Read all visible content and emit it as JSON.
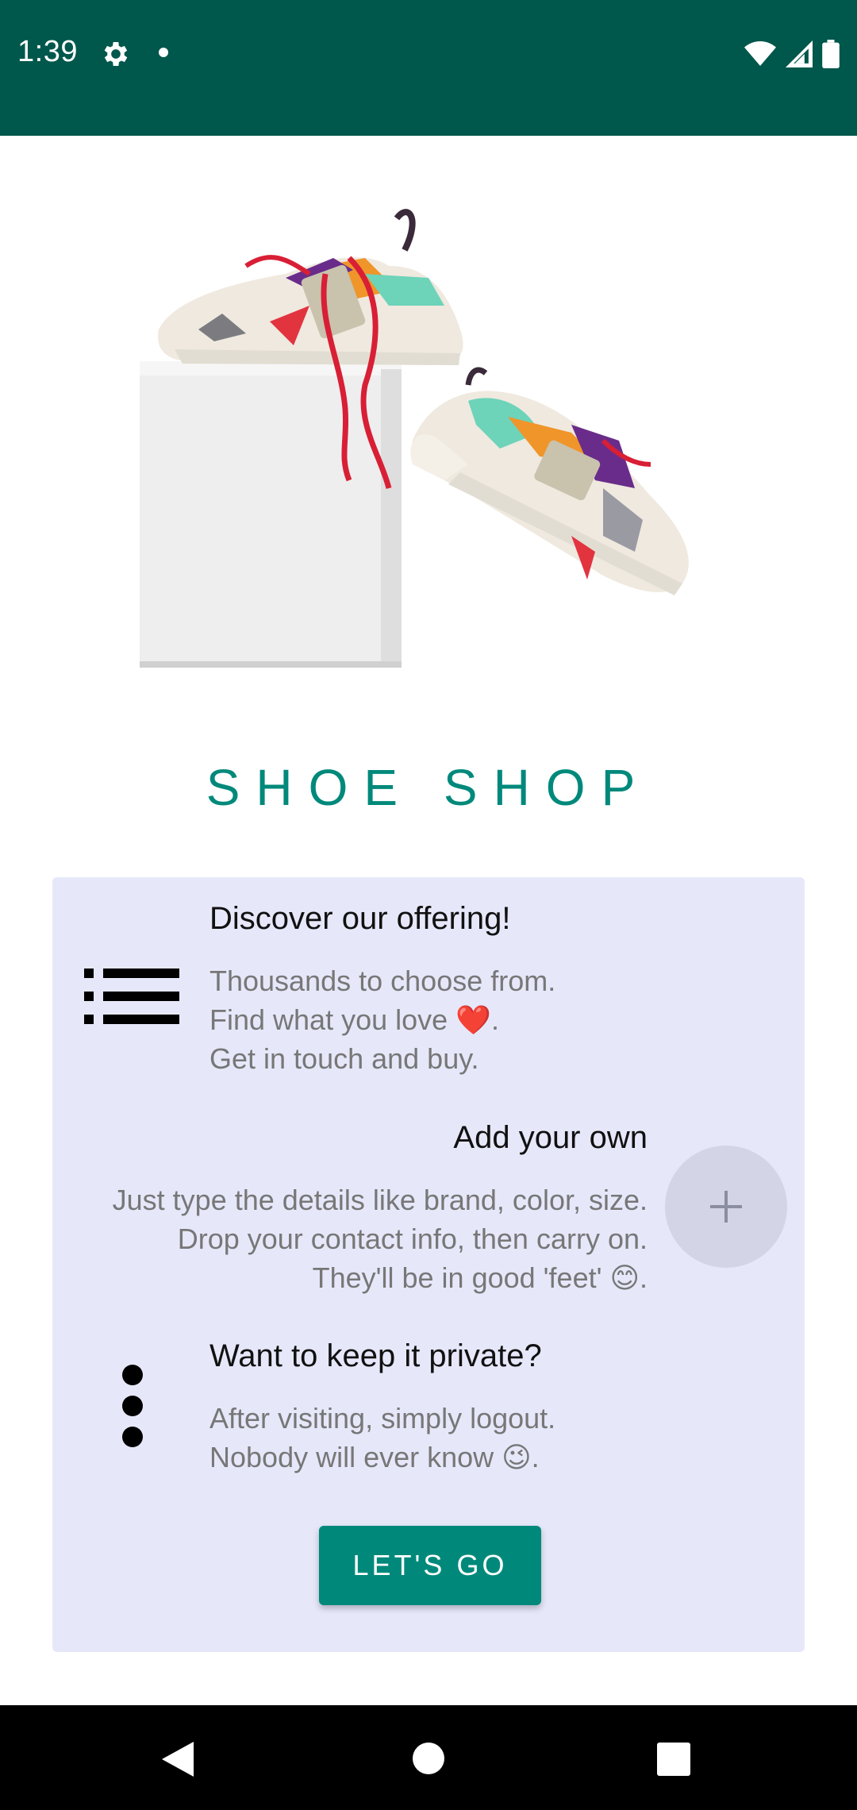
{
  "status_bar": {
    "time": "1:39",
    "icons": [
      "gear-icon",
      "notification-dot-icon",
      "wifi-icon",
      "signal-icon",
      "battery-icon"
    ],
    "background": "#00574b"
  },
  "hero": {
    "image": "sneakers-on-box-image"
  },
  "title": "SHOE SHOP",
  "card": {
    "background": "#e6e8fa",
    "sections": [
      {
        "heading": "Discover our offering!",
        "lines": [
          "Thousands to choose from.",
          "Find what you love ❤️.",
          "Get in touch and buy."
        ],
        "icon": "list-icon"
      },
      {
        "heading": "Add your own",
        "lines": [
          "Just type the details like brand, color, size.",
          "Drop your contact info, then carry on.",
          "They'll be in good 'feet' 😊."
        ],
        "icon": "plus-icon"
      },
      {
        "heading": "Want to keep it private?",
        "lines": [
          "After visiting, simply logout.",
          "Nobody will ever know 😉."
        ],
        "icon": "more-vert-icon"
      }
    ],
    "cta_label": "LET'S GO"
  },
  "nav_bar": {
    "icons": [
      "back-icon",
      "home-icon",
      "recents-icon"
    ]
  },
  "colors": {
    "accent": "#00897b",
    "status_bar": "#00574b",
    "card": "#e6e8fa"
  }
}
